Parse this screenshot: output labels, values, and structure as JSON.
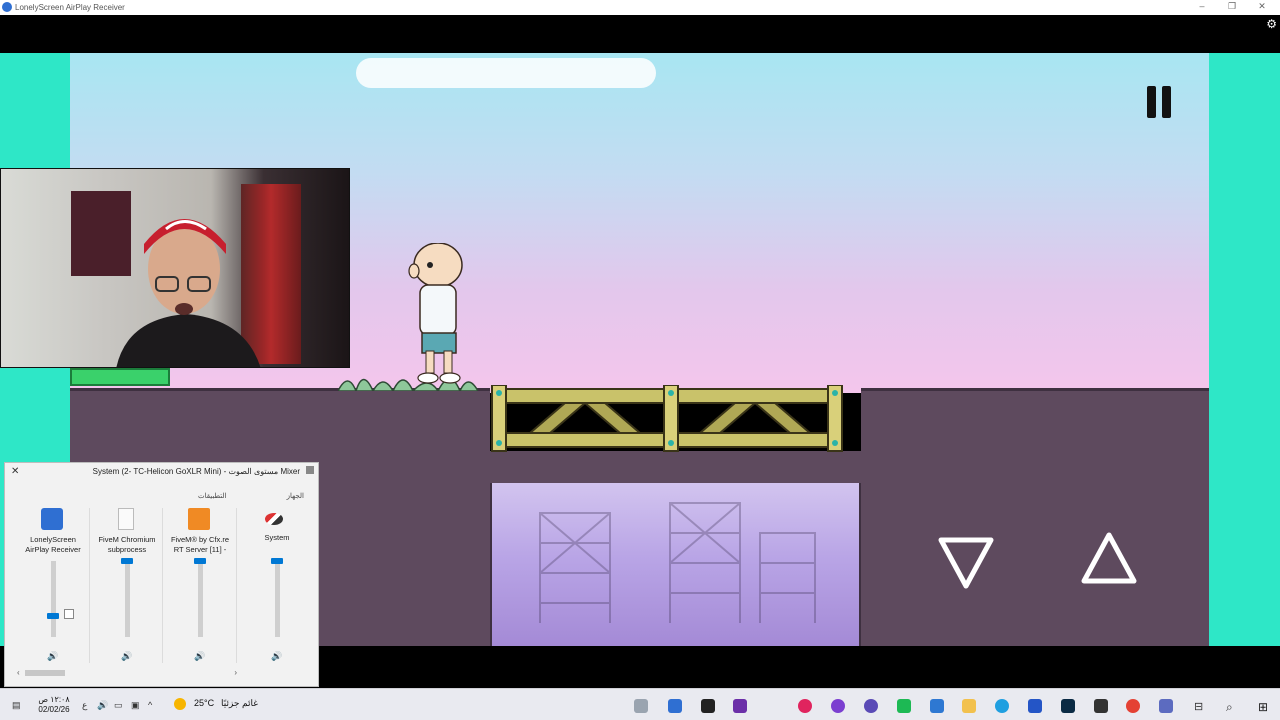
{
  "window": {
    "title": "LonelyScreen AirPlay Receiver",
    "controls": [
      "–",
      "❐",
      "✕"
    ]
  },
  "game": {
    "pause_icon": "pause-icon",
    "down_button_icon": "triangle-down-icon",
    "up_button_icon": "triangle-up-icon"
  },
  "mixer": {
    "title": "System (2- TC-Helicon GoXLR Mini) - مستوى الصوت Mixer",
    "device_label": "الجهاز",
    "apps_label": "التطبيقات",
    "apps": [
      {
        "name_line1": "LonelyScreen",
        "name_line2": "AirPlay Receiver",
        "level": 0.27,
        "icon": "monitor-icon"
      },
      {
        "name_line1": "FiveM Chromium",
        "name_line2": "subprocess",
        "level": 1.0,
        "icon": "document-icon"
      },
      {
        "name_line1": "FiveM® by Cfx.re",
        "name_line2": "RT Server [11] -",
        "level": 1.0,
        "icon": "fivem-icon"
      },
      {
        "name_line1": "System",
        "name_line2": "",
        "level": 1.0,
        "icon": "speaker-system-icon"
      }
    ]
  },
  "taskbar": {
    "time": "١٢:٠٨ ص",
    "date": "02/02/26",
    "weather_temp": "25°C",
    "weather_text": "غائم جزئيًا",
    "lang": "ع"
  }
}
